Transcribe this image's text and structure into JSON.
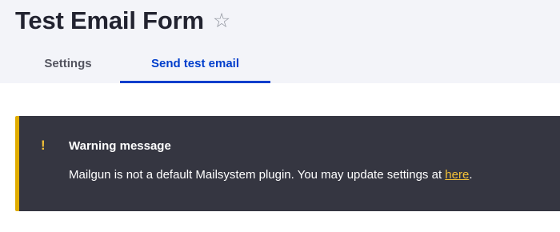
{
  "header": {
    "title": "Test Email Form",
    "star_glyph": "☆",
    "star_icon": "star-outline-icon"
  },
  "tabs": [
    {
      "label": "Settings",
      "active": false
    },
    {
      "label": "Send test email",
      "active": true
    }
  ],
  "warning": {
    "icon_glyph": "!",
    "icon": "exclamation-icon",
    "title": "Warning message",
    "text_before": "Mailgun is not a default Mailsystem plugin. You may update settings at ",
    "link_text": "here",
    "text_after": ".",
    "accent_color": "#e0ac00",
    "background_color": "#353641"
  },
  "colors": {
    "active_tab": "#003ecc",
    "header_background": "#f3f4f9"
  }
}
